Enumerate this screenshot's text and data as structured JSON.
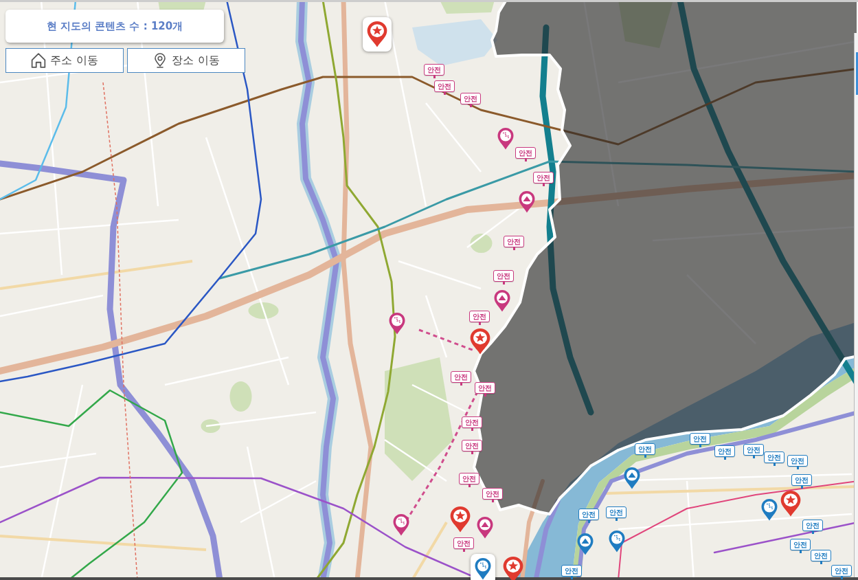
{
  "content_counter": {
    "text": "현 지도의 콘텐츠 수 : 120개"
  },
  "nav_buttons": [
    {
      "kind": "address",
      "label": "주소 이동"
    },
    {
      "kind": "place",
      "label": "장소 이동"
    }
  ],
  "markers": [
    {
      "kind": "star",
      "color": "#e03a2f",
      "highlighted": true
    },
    {
      "kind": "sign",
      "label": "안전",
      "color": "#c8387e",
      "highlighted": false
    },
    {
      "kind": "sign",
      "label": "안전",
      "color": "#c8387e",
      "highlighted": false
    },
    {
      "kind": "sign",
      "label": "안전",
      "color": "#c8387e",
      "highlighted": false
    },
    {
      "kind": "route",
      "color": "#c8387e",
      "highlighted": false
    },
    {
      "kind": "sign",
      "label": "안전",
      "color": "#c8387e",
      "highlighted": false
    },
    {
      "kind": "sign",
      "label": "안전",
      "color": "#c8387e",
      "highlighted": false
    },
    {
      "kind": "mountain",
      "color": "#c8387e",
      "highlighted": false
    },
    {
      "kind": "sign",
      "label": "안전",
      "color": "#c8387e",
      "highlighted": false
    },
    {
      "kind": "sign",
      "label": "안전",
      "color": "#c8387e",
      "highlighted": false
    },
    {
      "kind": "mountain",
      "color": "#c8387e",
      "highlighted": false
    },
    {
      "kind": "sign",
      "label": "안전",
      "color": "#c8387e",
      "highlighted": false
    },
    {
      "kind": "route",
      "color": "#c8387e",
      "highlighted": false
    },
    {
      "kind": "star",
      "color": "#e03a2f",
      "highlighted": false
    },
    {
      "kind": "sign",
      "label": "안전",
      "color": "#c8387e",
      "highlighted": false
    },
    {
      "kind": "sign",
      "label": "안전",
      "color": "#c8387e",
      "highlighted": false
    },
    {
      "kind": "sign",
      "label": "안전",
      "color": "#c8387e",
      "highlighted": false
    },
    {
      "kind": "sign",
      "label": "안전",
      "color": "#c8387e",
      "highlighted": false
    },
    {
      "kind": "sign",
      "label": "안전",
      "color": "#c8387e",
      "highlighted": false
    },
    {
      "kind": "sign",
      "label": "안전",
      "color": "#c8387e",
      "highlighted": false
    },
    {
      "kind": "star",
      "color": "#e03a2f",
      "highlighted": false
    },
    {
      "kind": "route",
      "color": "#c8387e",
      "highlighted": false
    },
    {
      "kind": "mountain",
      "color": "#c8387e",
      "highlighted": false
    },
    {
      "kind": "sign",
      "label": "안전",
      "color": "#c8387e",
      "highlighted": false
    },
    {
      "kind": "route",
      "color": "#1f7cc1",
      "highlighted": true
    },
    {
      "kind": "star",
      "color": "#e03a2f",
      "highlighted": false
    },
    {
      "kind": "sign",
      "label": "안전",
      "color": "#1f7cc1",
      "highlighted": false
    },
    {
      "kind": "sign",
      "label": "안전",
      "color": "#1f7cc1",
      "highlighted": false
    },
    {
      "kind": "sign",
      "label": "안전",
      "color": "#1f7cc1",
      "highlighted": false
    },
    {
      "kind": "sign",
      "label": "안전",
      "color": "#1f7cc1",
      "highlighted": false
    },
    {
      "kind": "sign",
      "label": "안전",
      "color": "#1f7cc1",
      "highlighted": false
    },
    {
      "kind": "sign",
      "label": "안전",
      "color": "#1f7cc1",
      "highlighted": false
    },
    {
      "kind": "mountain",
      "color": "#1f7cc1",
      "highlighted": false
    },
    {
      "kind": "sign",
      "label": "안전",
      "color": "#1f7cc1",
      "highlighted": false
    },
    {
      "kind": "star",
      "color": "#e03a2f",
      "highlighted": false
    },
    {
      "kind": "route",
      "color": "#1f7cc1",
      "highlighted": false
    },
    {
      "kind": "sign",
      "label": "안전",
      "color": "#1f7cc1",
      "highlighted": false
    },
    {
      "kind": "sign",
      "label": "안전",
      "color": "#1f7cc1",
      "highlighted": false
    },
    {
      "kind": "sign",
      "label": "안전",
      "color": "#1f7cc1",
      "highlighted": false
    },
    {
      "kind": "mountain",
      "color": "#1f7cc1",
      "highlighted": false
    },
    {
      "kind": "route",
      "color": "#1f7cc1",
      "highlighted": false
    },
    {
      "kind": "sign",
      "label": "안전",
      "color": "#1f7cc1",
      "highlighted": false
    },
    {
      "kind": "sign",
      "label": "안전",
      "color": "#1f7cc1",
      "highlighted": false
    },
    {
      "kind": "sign",
      "label": "안전",
      "color": "#1f7cc1",
      "highlighted": false
    },
    {
      "kind": "sign",
      "label": "안전",
      "color": "#1f7cc1",
      "highlighted": false
    }
  ]
}
